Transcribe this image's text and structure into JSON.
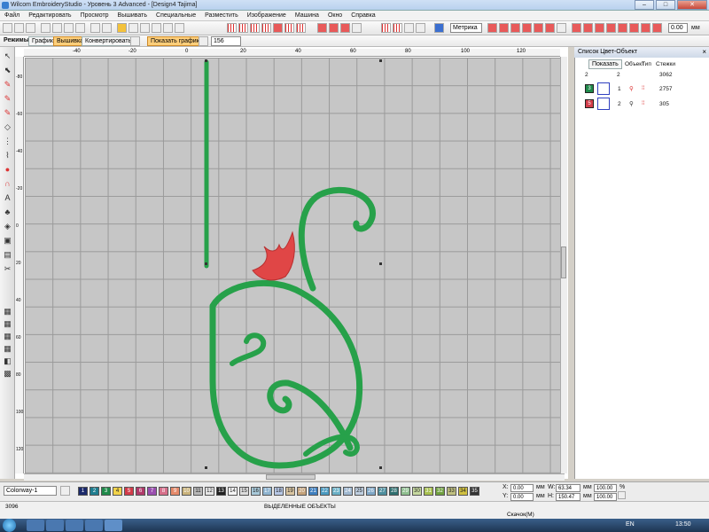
{
  "window": {
    "title": "Wilcom EmbroideryStudio - Уровень 3 Advanced - [Design4     Tajima]",
    "min": "–",
    "max": "□",
    "close": "✕"
  },
  "menu": [
    "Файл",
    "Редактировать",
    "Просмотр",
    "Вышивать",
    "Специальные",
    "Разместить",
    "Изображение",
    "Машина",
    "Окно",
    "Справка"
  ],
  "toolbar2": {
    "mode_label": "Режимы:",
    "graphics_btn": "Графика",
    "embroidery_btn": "Вышивка",
    "convert_btn": "Конвертировать",
    "show_graphics_btn": "Показать графику",
    "zoom_value": "156",
    "units": "Метрика",
    "angle_value": "0.00",
    "angle_unit": "мм"
  },
  "panel": {
    "title": "Список Цвет-Объект",
    "show_btn": "Показать",
    "col_object": "Объект",
    "col_type": "Тип",
    "col_stitches": "Стежки",
    "header_row": {
      "a": "2",
      "b": "2",
      "stitches": "3062"
    },
    "rows": [
      {
        "swatch": "3",
        "index": "1",
        "stitches": "2757",
        "color": "#1f8a4a"
      },
      {
        "swatch": "5",
        "index": "2",
        "stitches": "305",
        "color": "#d23c4a"
      }
    ]
  },
  "colorway": {
    "label": "Colorway-1",
    "swatches": [
      {
        "n": "1",
        "c": "#1c2a6b"
      },
      {
        "n": "2",
        "c": "#1f7d8f"
      },
      {
        "n": "3",
        "c": "#1f8a4a"
      },
      {
        "n": "4",
        "c": "#f2d34a"
      },
      {
        "n": "5",
        "c": "#d23c4a"
      },
      {
        "n": "6",
        "c": "#b03a6a"
      },
      {
        "n": "7",
        "c": "#9b4fb0"
      },
      {
        "n": "8",
        "c": "#d66f8a"
      },
      {
        "n": "9",
        "c": "#e58a6a"
      },
      {
        "n": "10",
        "c": "#c9b27a"
      },
      {
        "n": "11",
        "c": "#b7b7b7"
      },
      {
        "n": "12",
        "c": "#e6e6e6"
      },
      {
        "n": "13",
        "c": "#222222"
      },
      {
        "n": "14",
        "c": "#f5f5f5"
      },
      {
        "n": "15",
        "c": "#dcdcdc"
      },
      {
        "n": "16",
        "c": "#a8c9d9"
      },
      {
        "n": "17",
        "c": "#8fb4d0"
      },
      {
        "n": "18",
        "c": "#b7c8e6"
      },
      {
        "n": "19",
        "c": "#d8c4a0"
      },
      {
        "n": "20",
        "c": "#c4a27a"
      },
      {
        "n": "21",
        "c": "#3f7fbf"
      },
      {
        "n": "22",
        "c": "#4a9ac0"
      },
      {
        "n": "23",
        "c": "#6ab0c6"
      },
      {
        "n": "24",
        "c": "#a0b8d0"
      },
      {
        "n": "25",
        "c": "#bfcfe0"
      },
      {
        "n": "26",
        "c": "#7fa7c7"
      },
      {
        "n": "27",
        "c": "#4e8f9e"
      },
      {
        "n": "28",
        "c": "#2f6f6f"
      },
      {
        "n": "29",
        "c": "#8fbf8f"
      },
      {
        "n": "30",
        "c": "#c7d9a0"
      },
      {
        "n": "31",
        "c": "#a7c04f"
      },
      {
        "n": "32",
        "c": "#6f9f3f"
      },
      {
        "n": "33",
        "c": "#c0c080"
      },
      {
        "n": "34",
        "c": "#d0c040"
      },
      {
        "n": "35",
        "c": "#333333"
      }
    ]
  },
  "coords": {
    "x_label": "X:",
    "x_val": "0.00",
    "x_unit": "мм",
    "y_label": "Y:",
    "y_val": "0.00",
    "y_unit": "мм",
    "w_label": "W:",
    "w_val": "63.34",
    "w_unit": "мм",
    "h_label": "H:",
    "h_val": "150.47",
    "h_unit": "мм",
    "pct1": "100.00",
    "pct2": "100.00",
    "pct_unit": "%"
  },
  "status": {
    "count": "3096",
    "selected": "ВЫДЕЛЕННЫЕ ОБЪЕКТЫ",
    "mode": "Скачок(M)"
  },
  "taskbar": {
    "lang": "EN",
    "clock": "13:50"
  },
  "rulers": {
    "h": [
      "-40",
      "-20",
      "0",
      "20",
      "40",
      "60",
      "80",
      "100",
      "120"
    ],
    "v": [
      "-80",
      "-60",
      "-40",
      "-20",
      "0",
      "20",
      "40",
      "60",
      "80",
      "100",
      "120"
    ]
  },
  "colors": {
    "stitch_green": "#27a14a",
    "stitch_red": "#e04646",
    "grid": "#c6c6c6"
  }
}
